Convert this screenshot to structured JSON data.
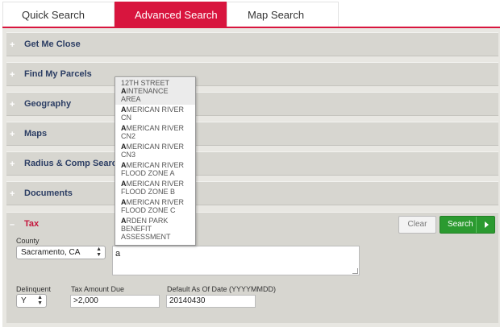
{
  "tabs": [
    {
      "label": "Quick Search"
    },
    {
      "label": "Advanced Search"
    },
    {
      "label": "Map Search"
    }
  ],
  "sections": [
    {
      "label": "Get Me Close",
      "toggle": "+"
    },
    {
      "label": "Find My Parcels",
      "toggle": "+"
    },
    {
      "label": "Geography",
      "toggle": "+"
    },
    {
      "label": "Maps",
      "toggle": "+"
    },
    {
      "label": "Radius & Comp Search",
      "toggle": "+"
    },
    {
      "label": "Documents",
      "toggle": "+"
    },
    {
      "label": "Tax",
      "toggle": "–"
    }
  ],
  "tax": {
    "county_label": "County",
    "county_value": "Sacramento, CA",
    "search_text": "a",
    "delinquent_label": "Delinquent",
    "delinquent_value": "Y",
    "amount_label": "Tax Amount Due",
    "amount_value": ">2,000",
    "date_label": "Default As Of Date (YYYYMMDD)",
    "date_value": "20140430",
    "clear_label": "Clear",
    "search_label": "Search"
  },
  "autocomplete": {
    "items": [
      {
        "match": "",
        "line1": "12TH STREET",
        "line2": "MAINTENANCE",
        "line3": "AREA",
        "match2": "A"
      },
      {
        "match": "A",
        "line1": "MERICAN RIVER",
        "line2": "CN",
        "line3": ""
      },
      {
        "match": "A",
        "line1": "MERICAN RIVER",
        "line2": "CN2",
        "line3": ""
      },
      {
        "match": "A",
        "line1": "MERICAN RIVER",
        "line2": "CN3",
        "line3": ""
      },
      {
        "match": "A",
        "line1": "MERICAN RIVER",
        "line2": "FLOOD ZONE A",
        "line3": ""
      },
      {
        "match": "A",
        "line1": "MERICAN RIVER",
        "line2": "FLOOD ZONE B",
        "line3": ""
      },
      {
        "match": "A",
        "line1": "MERICAN RIVER",
        "line2": "FLOOD ZONE C",
        "line3": ""
      },
      {
        "match": "A",
        "line1": "RDEN PARK",
        "line2": "BENEFIT",
        "line3": "ASSESSMENT"
      }
    ]
  },
  "colors": {
    "accent": "#d8153e",
    "section_title": "#2c3e64",
    "search_button": "#2b9a30"
  },
  "icons": {
    "expand": "plus-icon",
    "collapse": "minus-icon",
    "select": "up-down-arrows-icon",
    "search_button": "caret-right-icon"
  }
}
